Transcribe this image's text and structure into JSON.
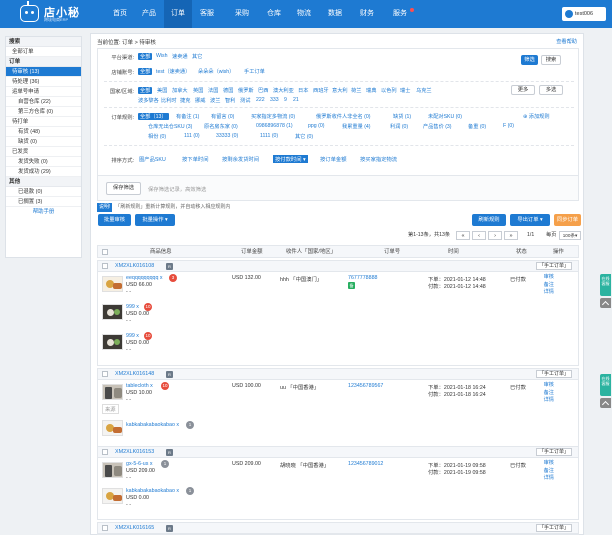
{
  "app": {
    "logo_title": "店小秘",
    "logo_subtitle": "跨境电商ERP",
    "user": "test006"
  },
  "nav": [
    "首页",
    "产品",
    "订单",
    "客服",
    "采购",
    "仓库",
    "物流",
    "数据",
    "财务",
    "服务"
  ],
  "sidebar": {
    "search_title": "搜索",
    "all_orders": "全部订单",
    "order_title": "订单",
    "items": [
      {
        "label": "待审核  (13)",
        "active": true,
        "sub": false
      },
      {
        "label": "待处理  (36)",
        "sub": false
      },
      {
        "label": "运单号申请",
        "sub": false
      },
      {
        "label": "自营仓库  (22)",
        "sub": true
      },
      {
        "label": "第三方仓库  (0)",
        "sub": true
      },
      {
        "label": "待打单",
        "sub": false
      },
      {
        "label": "有货  (48)",
        "sub": true
      },
      {
        "label": "缺货  (0)",
        "sub": true
      },
      {
        "label": "已发货",
        "sub": false
      },
      {
        "label": "发货失败  (0)",
        "sub": true
      },
      {
        "label": "发货成功  (29)",
        "sub": true
      }
    ],
    "other_title": "其他",
    "others": [
      "已退款  (0)",
      "已搁置  (3)"
    ],
    "help": "帮助手册"
  },
  "main": {
    "crumb": "当前位置:  订单 > 待审核",
    "crumb_link": "查看帮助",
    "filters": {
      "platform_label": "平台渠道:",
      "platforms": [
        "全部",
        "Wish",
        "速卖通",
        "其它"
      ],
      "store_label": "店铺账号:",
      "stores": [
        "全部",
        "test（速卖通）",
        "朵朵朵（wish）",
        "手工订单"
      ],
      "filter_btn": "筛选",
      "search_btn": "搜索",
      "country_label": "国家/区域:",
      "countries_row1": [
        "全部",
        "美国",
        "加拿大",
        "英国",
        "法国",
        "德国",
        "俄罗斯",
        "巴西",
        "澳大利亚",
        "日本",
        "西班牙",
        "意大利",
        "荷兰",
        "瑞典",
        "以色列",
        "瑞士",
        "乌克兰"
      ],
      "countries_row2": [
        "波多黎各",
        "比利时",
        "捷克",
        "挪威",
        "波兰",
        "智利",
        "测试",
        "222",
        "333",
        "9",
        "21"
      ],
      "more_btn": "更多",
      "multi_btn": "多选",
      "rule_label": "订单规则:",
      "rules_row1": [
        "全部（13）",
        "有备注 (1)",
        "有留言 (0)",
        "买家指定多物流 (0)",
        "俄罗斯收件人非全名 (0)",
        "缺货 (1)",
        "未配对SKU (0)"
      ],
      "rules_row2": [
        "仓库无出仓SKU (3)",
        "原名房东家 (0)",
        "0986896878 (1)",
        "ppg (0)",
        "我累重量 (4)",
        "利润 (0)",
        "产品售价 (3)",
        "备重 (0)",
        "F (0)"
      ],
      "rules_row3": [
        "相份 (0)",
        "111 (0)",
        "33333 (0)",
        "1111 (0)",
        "其它 (0)"
      ],
      "add_rule": "添加规则",
      "sort_label": "排序方式:",
      "sorts": [
        "图产品SKU",
        "按下单时间",
        "按剩余发货时间",
        "按付款时间",
        "按订单金额",
        "按买家指定物流"
      ],
      "save_btn": "保存筛选",
      "save_hint": "保存筛选记录，高效筛选"
    },
    "note_tag": "说明!",
    "note_text": "「刷新规则」重新计算规则，并自动移入相应规则内",
    "toolbar": {
      "bulk_review": "批量审核",
      "bulk_ops": "批量操作",
      "refresh_rules": "刷新规则",
      "export": "导出订单",
      "sync": "同步订单"
    },
    "pager": {
      "info": "第1-13条，共13条",
      "page": "1/1",
      "per_page_label": "每页",
      "per_page": "100条"
    },
    "columns": [
      "商品信息",
      "订单金额",
      "收件人「国家/地区」",
      "订单号",
      "时间",
      "状态",
      "操作"
    ],
    "groups": [
      {
        "id": "XM2XLK016108",
        "badge": "R",
        "manual": "「手工订单」",
        "items": [
          {
            "name": "eeqqqqqqqqq x",
            "qty": "3",
            "price": "USD 66.00",
            "dash": "- -"
          },
          {
            "name": "999 x",
            "qty": "10",
            "price": "USD 0.00",
            "dash": "- -"
          },
          {
            "name": "999 x",
            "qty": "10",
            "price": "USD 0.00",
            "dash": "- -"
          }
        ],
        "amount": "USD 132.00",
        "receiver": "hhh 「中国澳门」",
        "order_no": "7677778888",
        "order_tag": "备",
        "order_time": "下单：2021-01-12 14:48",
        "pay_time": "付款：2021-01-12 14:48",
        "status": "已付款",
        "ops": [
          "审核",
          "备注",
          "详情"
        ]
      },
      {
        "id": "XM2XLK016148",
        "badge": "R",
        "manual": "「手工订单」",
        "items": [
          {
            "name": "tablecloth x",
            "qty": "10",
            "price": "USD 10.00",
            "dash": "- -"
          },
          {
            "name": "kabkabakabaokabao x",
            "qty": "1",
            "price": "",
            "dash": ""
          }
        ],
        "item_tag": "来源",
        "amount": "USD 100.00",
        "receiver": "uu 「中国香港」",
        "order_no": "123456789567",
        "order_time": "下单：2021-01-18 16:24",
        "pay_time": "付款：2021-01-18 16:24",
        "status": "已付款",
        "ops": [
          "审核",
          "备注",
          "详情"
        ]
      },
      {
        "id": "XM2XLK016153",
        "badge": "R",
        "manual": "「手工订单」",
        "items": [
          {
            "name": "gx-5-6-us x",
            "qty": "1",
            "price": "USD 209.00",
            "dash": "- -"
          },
          {
            "name": "kabkabakabaokabao x",
            "qty": "1",
            "price": "USD 0.00",
            "dash": "- -"
          }
        ],
        "amount": "USD 209.00",
        "receiver": "胡晓晓 「中国香港」",
        "order_no": "123456789012",
        "order_time": "下单：2021-01-19 09:58",
        "pay_time": "付款：2021-01-19 09:58",
        "status": "已付款",
        "ops": [
          "审核",
          "备注",
          "详情"
        ]
      },
      {
        "id": "XM2XLK016165",
        "badge": "R",
        "manual": "「手工订单」"
      }
    ],
    "float_label": "在线客服"
  }
}
